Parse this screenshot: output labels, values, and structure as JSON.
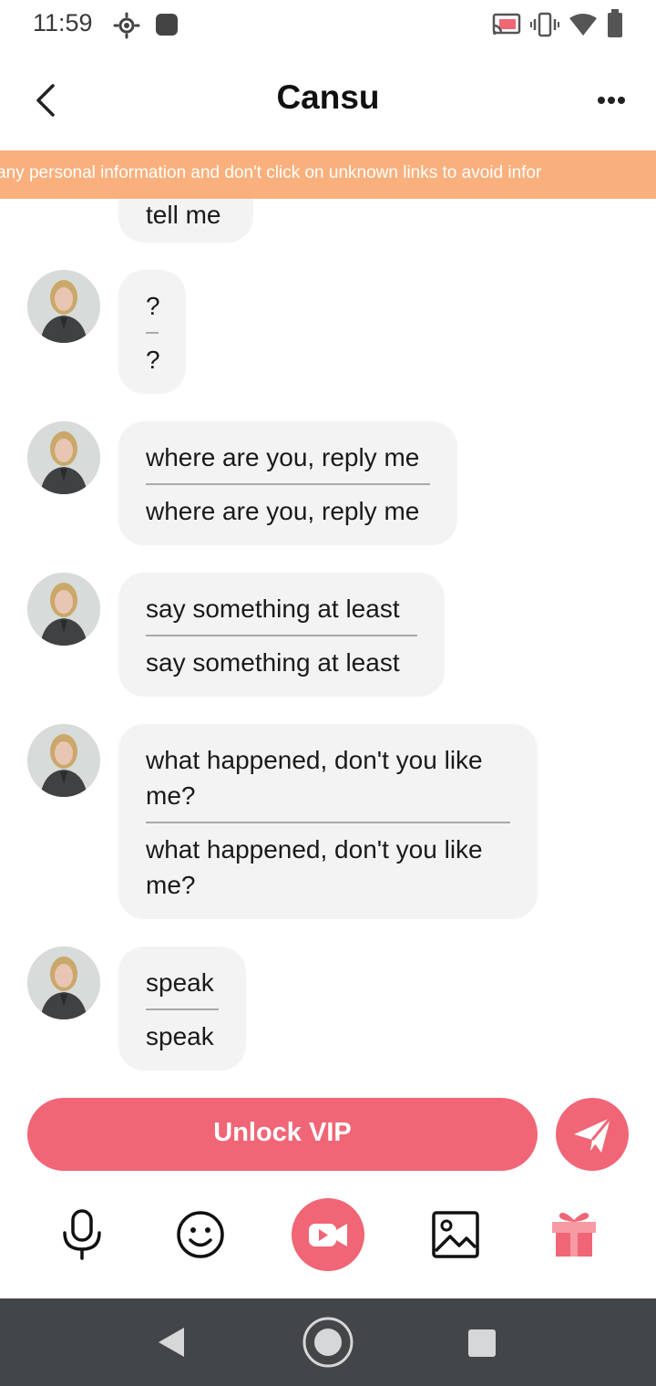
{
  "status": {
    "time": "11:59",
    "icons": [
      "settings-sun-icon",
      "stop-icon",
      "cast-icon",
      "vibrate-icon",
      "wifi-icon",
      "battery-icon"
    ]
  },
  "header": {
    "title": "Cansu",
    "back_icon": "chevron-left-icon",
    "more_icon": "more-horizontal-icon"
  },
  "notice": {
    "text": "al any personal information and don't click on unknown links to avoid infor"
  },
  "messages": [
    {
      "lines": [
        "tell me"
      ]
    },
    {
      "lines": [
        "?",
        "?"
      ]
    },
    {
      "lines": [
        "where are you, reply me",
        "where are you, reply me"
      ]
    },
    {
      "lines": [
        "say something at least",
        "say something at least"
      ]
    },
    {
      "lines": [
        "what happened, don't you like me?",
        "what happened, don't you like me?"
      ]
    },
    {
      "lines": [
        "speak",
        "speak"
      ]
    }
  ],
  "composer": {
    "vip_label": "Unlock VIP",
    "send_icon": "send-icon"
  },
  "toolbar": {
    "icons": [
      "microphone-icon",
      "emoji-icon",
      "video-call-icon",
      "image-icon",
      "gift-icon"
    ]
  },
  "colors": {
    "accent": "#f06676",
    "notice_bg": "#f9b07c",
    "bubble_bg": "#f3f3f3",
    "nav_bg": "#434649"
  }
}
